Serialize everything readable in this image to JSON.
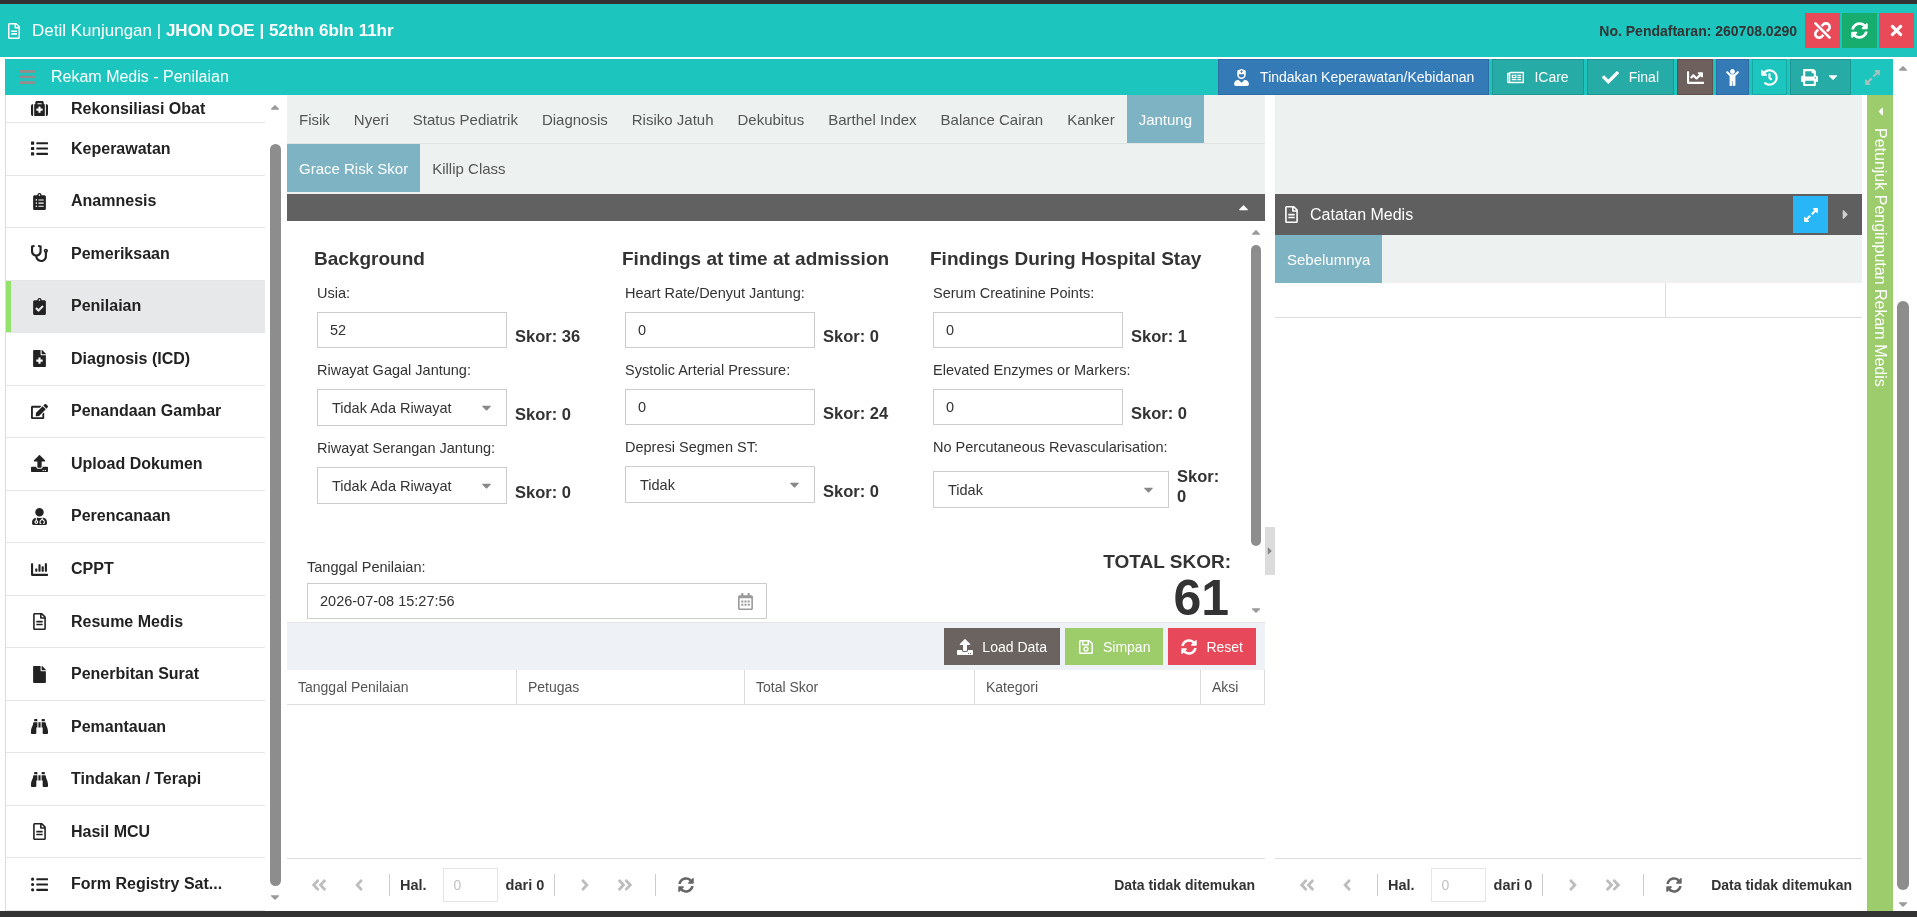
{
  "header": {
    "title": "Detil Kunjungan | **JHON DOE | 52thn 6bln 11hr**",
    "registration": "No. Pendaftaran: 260708.0290"
  },
  "toolbar": {
    "title": "Rekam Medis - Penilaian",
    "buttons": [
      {
        "label": "Tindakan Keperawatan/Kebidanan",
        "kind": "primary"
      },
      {
        "label": "ICare",
        "kind": "secondary"
      },
      {
        "label": "Final",
        "kind": "secondary"
      }
    ],
    "icon_buttons": [
      {
        "kind": "chart",
        "disabled": false
      },
      {
        "kind": "person",
        "disabled": false
      },
      {
        "kind": "history",
        "disabled": false
      },
      {
        "kind": "print",
        "disabled": false
      },
      {
        "kind": "expand",
        "disabled": true
      }
    ]
  },
  "sidebar": {
    "items": [
      {
        "label": "Rekonsiliasi Obat",
        "selected": false
      },
      {
        "label": "Keperawatan",
        "selected": false
      },
      {
        "label": "Anamnesis",
        "selected": false
      },
      {
        "label": "Pemeriksaan",
        "selected": false
      },
      {
        "label": "Penilaian",
        "selected": true
      },
      {
        "label": "Diagnosis (ICD)",
        "selected": false
      },
      {
        "label": "Penandaan Gambar",
        "selected": false
      },
      {
        "label": "Upload Dokumen",
        "selected": false
      },
      {
        "label": "Perencanaan",
        "selected": false
      },
      {
        "label": "CPPT",
        "selected": false
      },
      {
        "label": "Resume Medis",
        "selected": false
      },
      {
        "label": "Penerbitan Surat",
        "selected": false
      },
      {
        "label": "Pemantauan",
        "selected": false
      },
      {
        "label": "Tindakan / Terapi",
        "selected": false
      },
      {
        "label": "Hasil MCU",
        "selected": false
      },
      {
        "label": "Form Registry Sat...",
        "selected": false
      }
    ]
  },
  "tabs": [
    {
      "label": "Fisik",
      "selected": false
    },
    {
      "label": "Nyeri",
      "selected": false
    },
    {
      "label": "Status Pediatrik",
      "selected": false
    },
    {
      "label": "Diagnosis",
      "selected": false
    },
    {
      "label": "Risiko Jatuh",
      "selected": false
    },
    {
      "label": "Dekubitus",
      "selected": false
    },
    {
      "label": "Barthel Index",
      "selected": false
    },
    {
      "label": "Balance Cairan",
      "selected": false
    },
    {
      "label": "Kanker",
      "selected": false
    },
    {
      "label": "Jantung",
      "selected": true
    }
  ],
  "sub_tabs": [
    {
      "label": "Grace Risk Skor",
      "selected": true
    },
    {
      "label": "Killip Class",
      "selected": false
    }
  ],
  "form": {
    "sections": [
      {
        "title": "Background",
        "fields": [
          {
            "label": "Usia:",
            "kind": "input",
            "value": "52",
            "score": "Skor: 36"
          },
          {
            "label": "Riwayat Gagal Jantung:",
            "kind": "select",
            "value": "Tidak Ada Riwayat",
            "score": "Skor: 0"
          },
          {
            "label": "Riwayat Serangan Jantung:",
            "kind": "select",
            "value": "Tidak Ada Riwayat",
            "score": "Skor: 0"
          }
        ]
      },
      {
        "title": "Findings at time at admission",
        "fields": [
          {
            "label": "Heart Rate/Denyut Jantung:",
            "kind": "input",
            "value": "0",
            "score": "Skor: 0"
          },
          {
            "label": "Systolic Arterial Pressure:",
            "kind": "input",
            "value": "0",
            "score": "Skor: 24"
          },
          {
            "label": "Depresi Segmen ST:",
            "kind": "select",
            "value": "Tidak",
            "score": "Skor: 0"
          }
        ]
      },
      {
        "title": "Findings During Hospital Stay",
        "fields": [
          {
            "label": "Serum Creatinine Points:",
            "kind": "input",
            "value": "0",
            "score": "Skor: 1"
          },
          {
            "label": "Elevated Enzymes or Markers:",
            "kind": "input",
            "value": "0",
            "score": "Skor: 0"
          },
          {
            "label": "No Percutaneous Revascularisation:",
            "kind": "select",
            "value": "Tidak",
            "score": "Skor: 0"
          }
        ]
      }
    ],
    "date": {
      "label": "Tanggal Penilaian:",
      "value": "2026-07-08 15:27:56"
    },
    "total": {
      "label": "TOTAL SKOR:",
      "value": "61"
    }
  },
  "actions": [
    {
      "label": "Load Data",
      "kind": "load"
    },
    {
      "label": "Simpan",
      "kind": "save"
    },
    {
      "label": "Reset",
      "kind": "reset"
    }
  ],
  "table": {
    "columns": [
      "Tanggal Penilaian",
      "Petugas",
      "Total Skor",
      "Kategori",
      "Aksi"
    ],
    "pager": {
      "page_label": "Hal.",
      "page_value": "0",
      "total": "dari 0",
      "message": "Data tidak ditemukan",
      "disabled": true
    }
  },
  "notes_panel": {
    "title": "Catatan Medis",
    "tabs": [
      {
        "label": "Sebelumnya",
        "selected": true
      }
    ],
    "pager": {
      "page_label": "Hal.",
      "page_value": "0",
      "total": "dari 0",
      "message": "Data tidak ditemukan",
      "disabled": true
    }
  },
  "side_tab": {
    "label": "Petunjuk Penginputan Rekam Medis"
  }
}
